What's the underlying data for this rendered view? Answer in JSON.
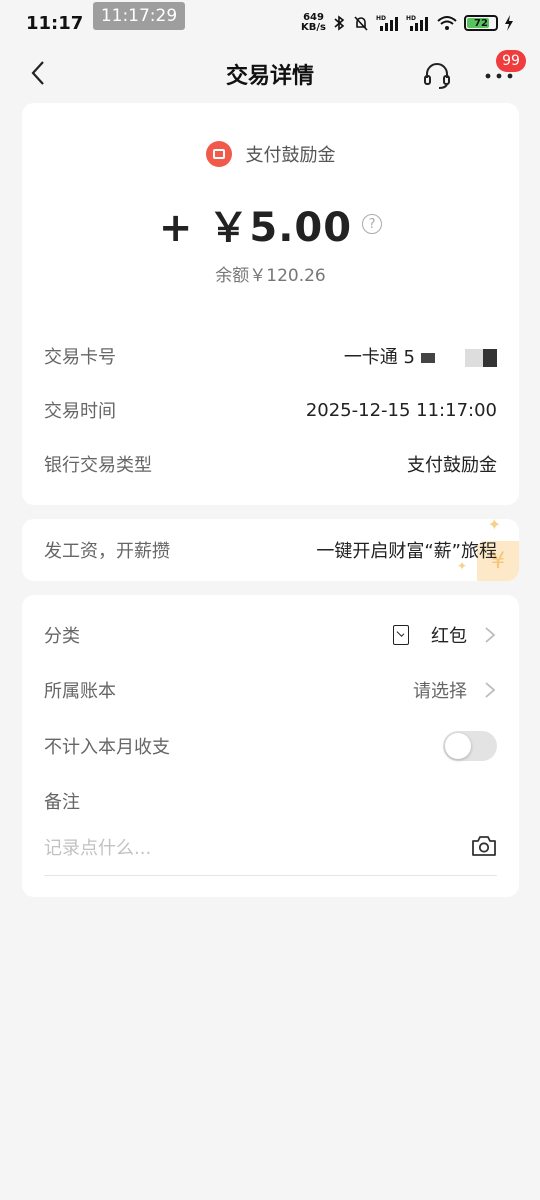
{
  "status_bar": {
    "time": "11:17",
    "overlay_time": "11:17:29",
    "speed_value": "649",
    "speed_unit": "KB/s",
    "hd1": "HD",
    "hd2": "HD",
    "battery": "72"
  },
  "header": {
    "title": "交易详情",
    "badge": "99",
    "icons": {
      "back": "back-chevron-icon",
      "service": "headset-icon",
      "more": "more-dots-icon"
    }
  },
  "transaction": {
    "type_label": "支付鼓励金",
    "amount": "+ ￥5.00",
    "help_glyph": "?",
    "balance": "余额￥120.26",
    "card_label": "交易卡号",
    "card_value": "一卡通 5",
    "time_label": "交易时间",
    "time_value": "2025-12-15 11:17:00",
    "bank_type_label": "银行交易类型",
    "bank_type_value": "支付鼓励金"
  },
  "promo": {
    "left": "发工资，开薪攒",
    "right": "一键开启财富“薪”旅程",
    "deco_glyph": "¥"
  },
  "form": {
    "category_label": "分类",
    "category_value": "红包",
    "account_label": "所属账本",
    "account_value": "请选择",
    "exclude_label": "不计入本月收支",
    "exclude_enabled": false,
    "note_label": "备注",
    "note_placeholder": "记录点什么..."
  },
  "colors": {
    "accent_red": "#f03c3c",
    "tx_icon": "#f15a4a",
    "background": "#f5f5f5",
    "battery_green": "#58c25c"
  }
}
